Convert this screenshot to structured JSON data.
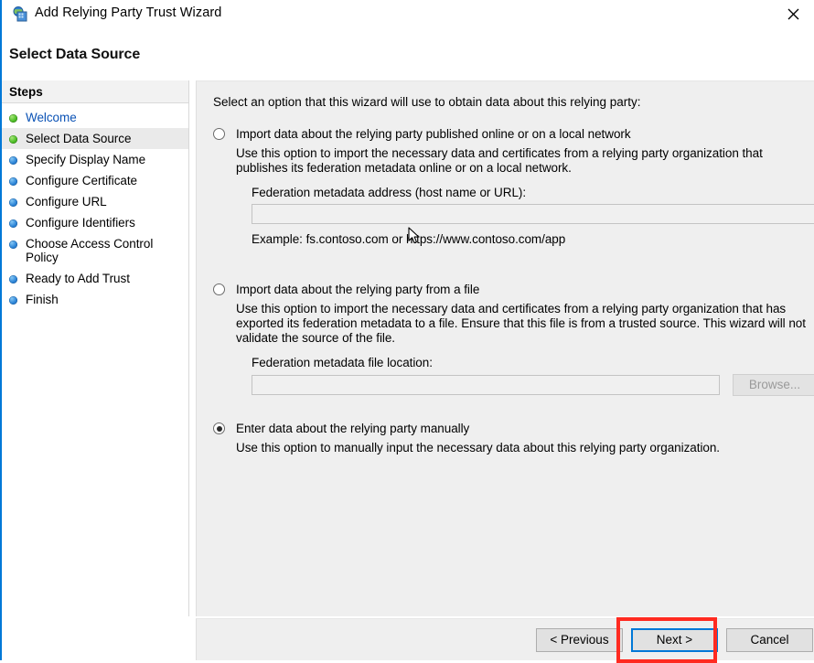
{
  "window": {
    "title": "Add Relying Party Trust Wizard",
    "icon": "wizard-shield-icon",
    "close_label": "✕",
    "accent_color": "#0078d7"
  },
  "page": {
    "title": "Select Data Source"
  },
  "sidebar": {
    "header": "Steps",
    "items": [
      {
        "label": "Welcome",
        "bullet": "green",
        "state": "completed-link"
      },
      {
        "label": "Select Data Source",
        "bullet": "green",
        "state": "current"
      },
      {
        "label": "Specify Display Name",
        "bullet": "blue",
        "state": "pending"
      },
      {
        "label": "Configure Certificate",
        "bullet": "blue",
        "state": "pending"
      },
      {
        "label": "Configure URL",
        "bullet": "blue",
        "state": "pending"
      },
      {
        "label": "Configure Identifiers",
        "bullet": "blue",
        "state": "pending"
      },
      {
        "label": "Choose Access Control Policy",
        "bullet": "blue",
        "state": "pending"
      },
      {
        "label": "Ready to Add Trust",
        "bullet": "blue",
        "state": "pending"
      },
      {
        "label": "Finish",
        "bullet": "blue",
        "state": "pending"
      }
    ]
  },
  "main": {
    "intro": "Select an option that this wizard will use to obtain data about this relying party:",
    "options": [
      {
        "label": "Import data about the relying party published online or on a local network",
        "selected": false,
        "description": "Use this option to import the necessary data and certificates from a relying party organization that publishes its federation metadata online or on a local network.",
        "field_label": "Federation metadata address (host name or URL):",
        "field_value": "",
        "field_placeholder": "",
        "example": "Example: fs.contoso.com or https://www.contoso.com/app"
      },
      {
        "label": "Import data about the relying party from a file",
        "selected": false,
        "description": "Use this option to import the necessary data and certificates from a relying party organization that has exported its federation metadata to a file. Ensure that this file is from a trusted source.  This wizard will not validate the source of the file.",
        "field_label": "Federation metadata file location:",
        "field_value": "",
        "field_placeholder": "",
        "browse_label": "Browse..."
      },
      {
        "label": "Enter data about the relying party manually",
        "selected": true,
        "description": "Use this option to manually input the necessary data about this relying party organization."
      }
    ]
  },
  "footer": {
    "previous_label": "< Previous",
    "next_label": "Next >",
    "cancel_label": "Cancel",
    "focused_button": "Next >",
    "annotation_color": "#ff2a20"
  }
}
